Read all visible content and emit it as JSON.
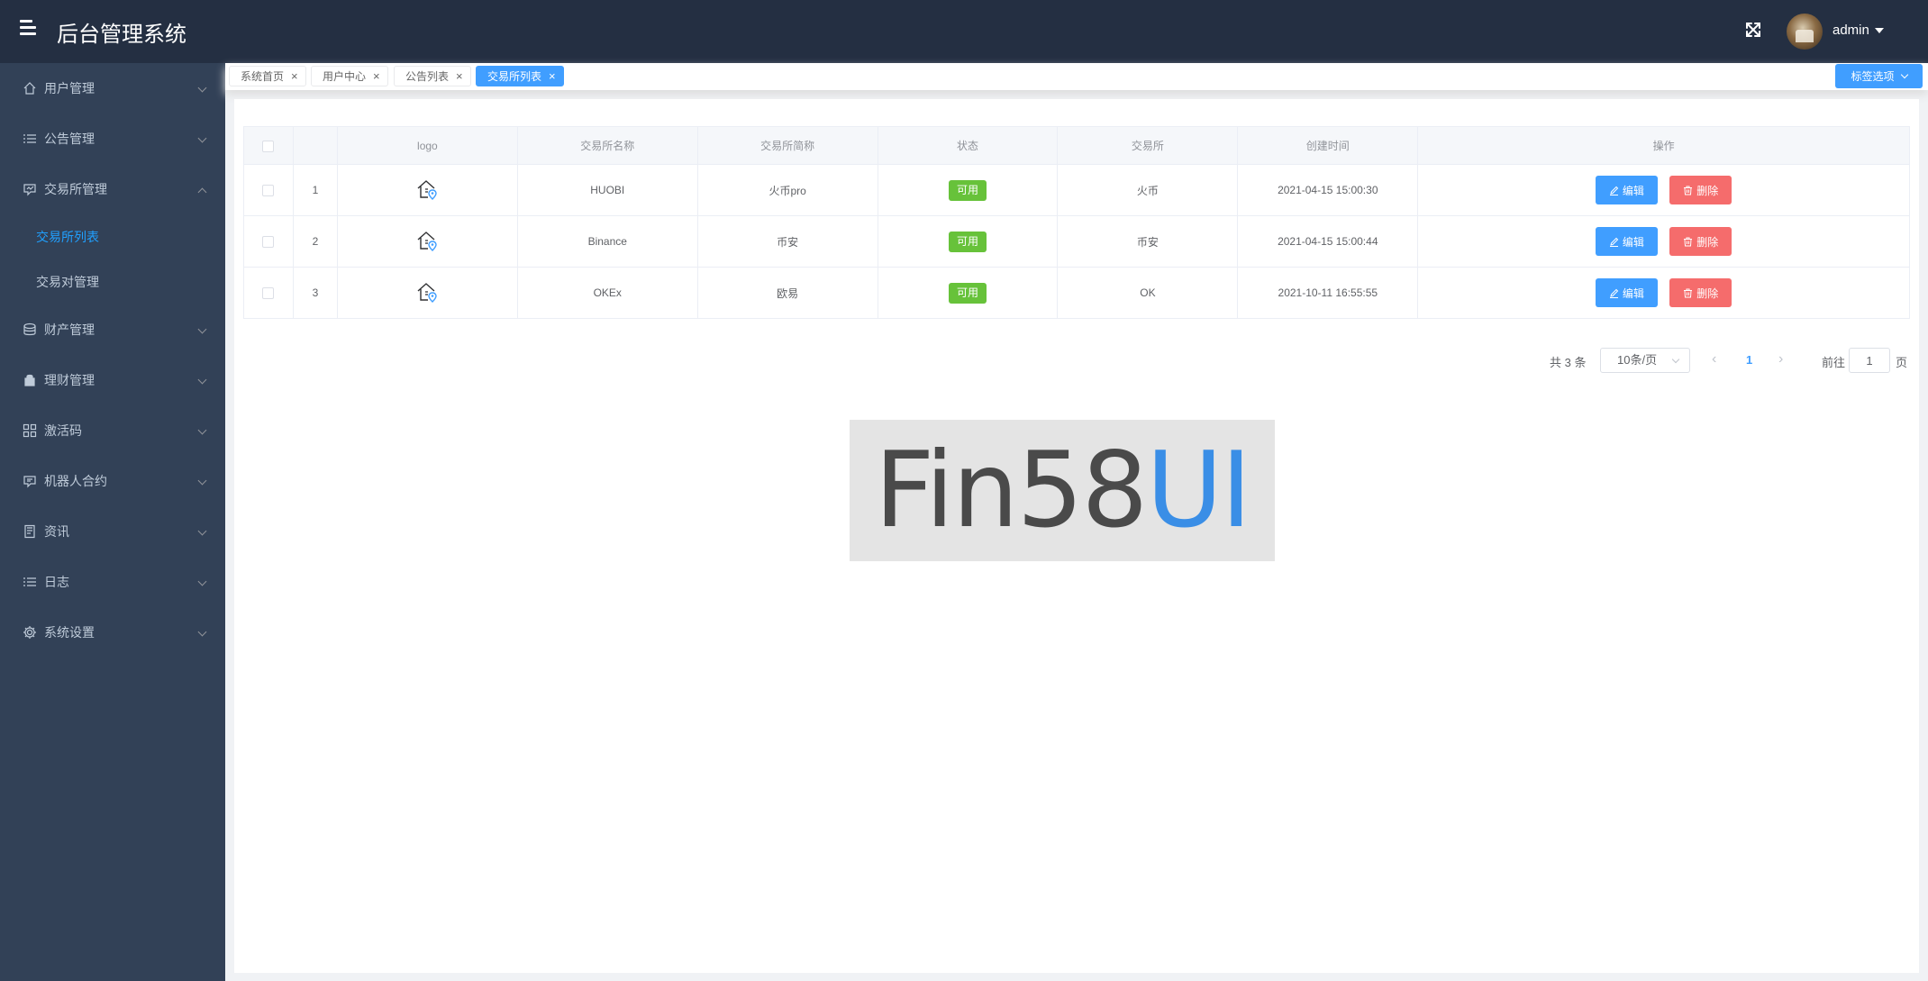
{
  "app": {
    "title": "后台管理系统"
  },
  "header": {
    "username": "admin"
  },
  "sidebar": {
    "items": [
      {
        "label": "用户管理",
        "icon": "home-icon",
        "expanded": false
      },
      {
        "label": "公告管理",
        "icon": "list-icon",
        "expanded": false
      },
      {
        "label": "交易所管理",
        "icon": "exchange-icon",
        "expanded": true,
        "children": [
          {
            "label": "交易所列表",
            "active": true
          },
          {
            "label": "交易对管理",
            "active": false
          }
        ]
      },
      {
        "label": "财产管理",
        "icon": "database-icon",
        "expanded": false
      },
      {
        "label": "理财管理",
        "icon": "bag-icon",
        "expanded": false
      },
      {
        "label": "激活码",
        "icon": "grid-icon",
        "expanded": false
      },
      {
        "label": "机器人合约",
        "icon": "contract-icon",
        "expanded": false
      },
      {
        "label": "资讯",
        "icon": "document-icon",
        "expanded": false
      },
      {
        "label": "日志",
        "icon": "list-icon",
        "expanded": false
      },
      {
        "label": "系统设置",
        "icon": "gear-icon",
        "expanded": false
      }
    ]
  },
  "tags": [
    {
      "label": "系统首页",
      "active": false
    },
    {
      "label": "用户中心",
      "active": false
    },
    {
      "label": "公告列表",
      "active": false
    },
    {
      "label": "交易所列表",
      "active": true
    }
  ],
  "tags_menu_label": "标签选项",
  "table": {
    "columns": [
      "",
      "",
      "logo",
      "交易所名称",
      "交易所简称",
      "状态",
      "交易所",
      "创建时间",
      "操作"
    ],
    "rows": [
      {
        "index": "1",
        "name": "HUOBI",
        "short": "火币pro",
        "status": "可用",
        "exchange": "火币",
        "created": "2021-04-15 15:00:30"
      },
      {
        "index": "2",
        "name": "Binance",
        "short": "币安",
        "status": "可用",
        "exchange": "币安",
        "created": "2021-04-15 15:00:44"
      },
      {
        "index": "3",
        "name": "OKEx",
        "short": "欧易",
        "status": "可用",
        "exchange": "OK",
        "created": "2021-10-11 16:55:55"
      }
    ],
    "edit_label": "编辑",
    "delete_label": "删除"
  },
  "pagination": {
    "total": "共 3 条",
    "page_size": "10条/页",
    "current_page": "1",
    "goto_label": "前往",
    "goto_value": "1",
    "page_unit": "页"
  },
  "watermark": {
    "text_dark": "Fin58",
    "text_blue": "UI"
  },
  "colors": {
    "header_bg": "#242f42",
    "sidebar_bg": "#324157",
    "accent": "#409eff",
    "success": "#67c23a",
    "danger": "#f56c6c"
  }
}
